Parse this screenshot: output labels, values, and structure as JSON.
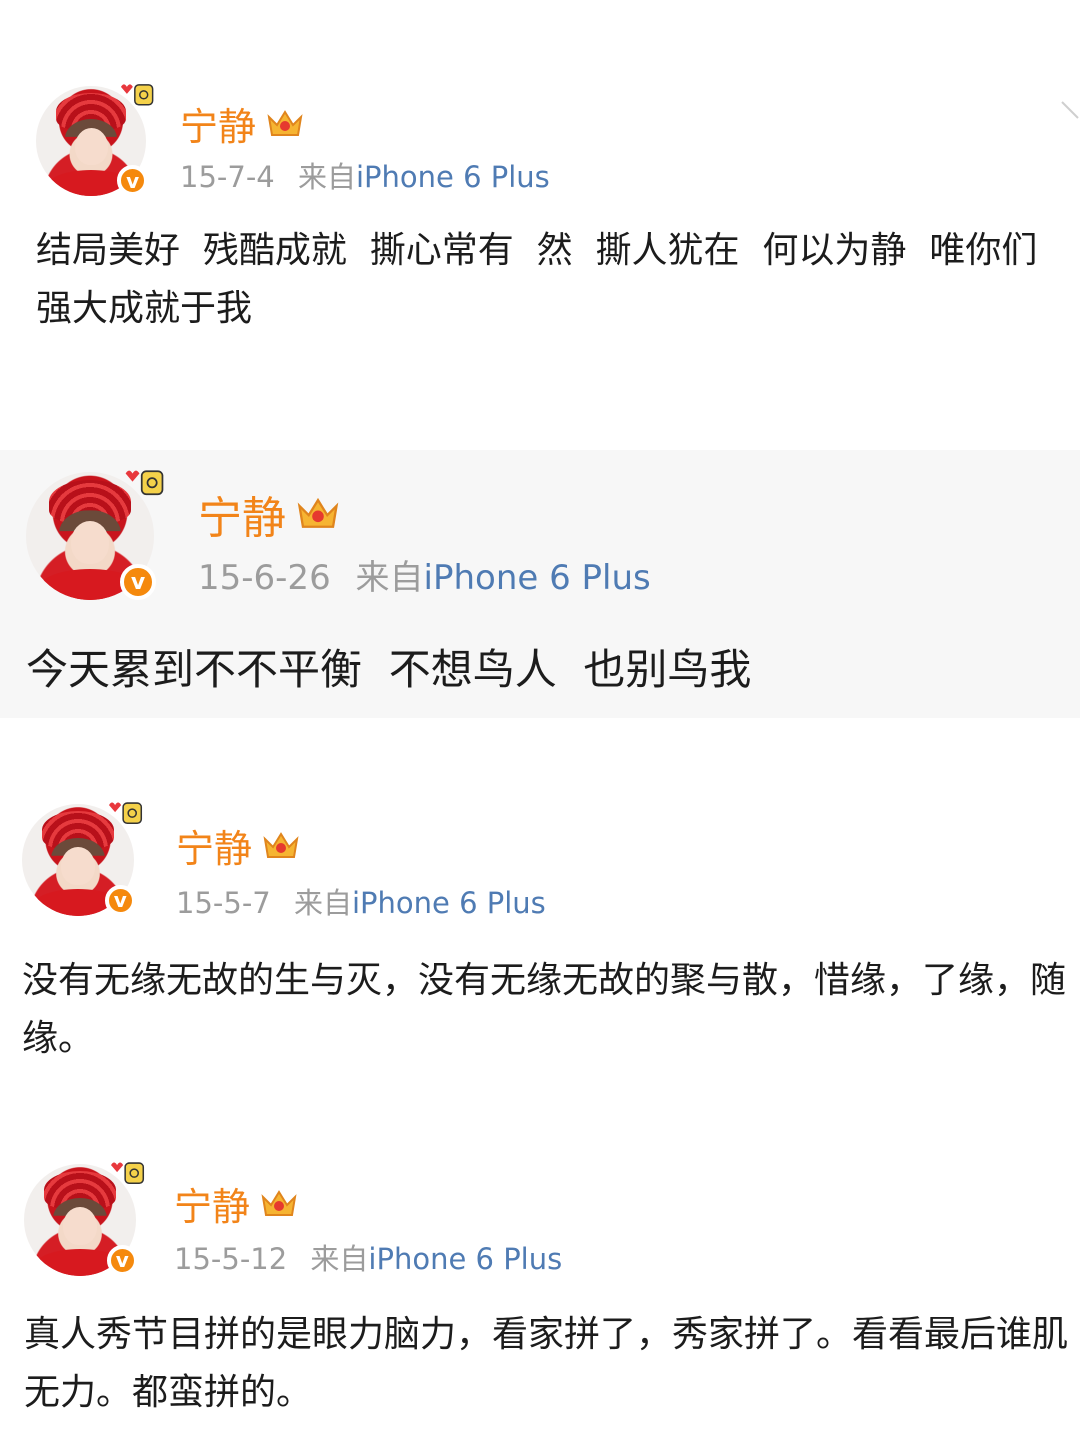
{
  "posts": [
    {
      "name": "宁静",
      "date": "15-7-4",
      "from_label": "来自",
      "source": "iPhone 6 Plus",
      "text": "结局美好  残酷成就  撕心常有  然  撕人犹在  何以为静  唯你们强大成就于我"
    },
    {
      "name": "宁静",
      "date": "15-6-26",
      "from_label": "来自",
      "source": "iPhone 6 Plus",
      "text": "今天累到不不平衡  不想鸟人  也别鸟我"
    },
    {
      "name": "宁静",
      "date": "15-5-7",
      "from_label": "来自",
      "source": "iPhone 6 Plus",
      "text": "没有无缘无故的生与灭，没有无缘无故的聚与散，惜缘，了缘，随缘。"
    },
    {
      "name": "宁静",
      "date": "15-5-12",
      "from_label": "来自",
      "source": "iPhone 6 Plus",
      "text": "真人秀节目拼的是眼力脑力，看家拼了，秀家拼了。看看最后谁肌无力。都蛮拼的。"
    }
  ],
  "icons": {
    "verified": "verified-v-badge",
    "member": "crown-icon",
    "avatar_deco": "perfume-heart-icon"
  },
  "colors": {
    "name": "#f28419",
    "source": "#4f7bb3",
    "meta": "#9c9c9c",
    "badge": "#f5890d"
  }
}
